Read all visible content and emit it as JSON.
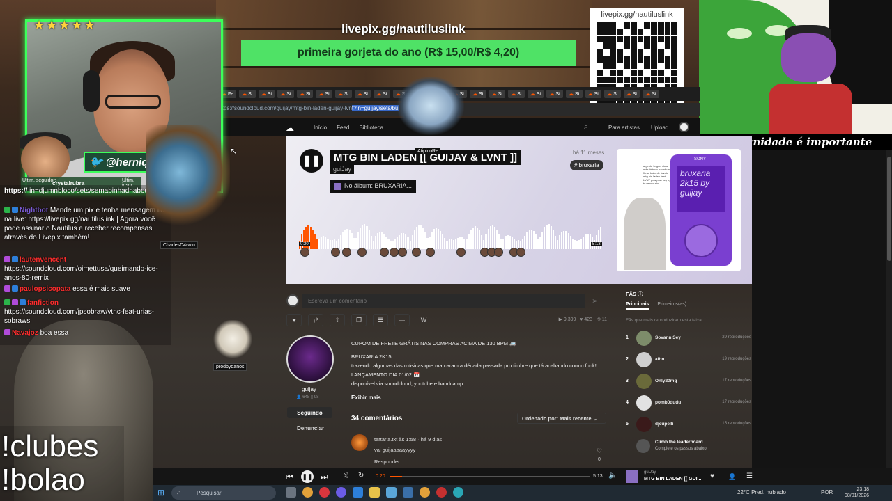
{
  "overlay": {
    "stars": "★★★★★",
    "livepix_url": "livepix.gg/nautiluslink",
    "donation_text": "primeira gorjeta do ano (R$ 15,00/R$ 4,20)",
    "qr_url": "livepix.gg/nautiluslink",
    "art_caption": "Comunidade é importante",
    "twitter_handle": "@herniq",
    "last_sub_label": "Ultim. seguidor:",
    "last_sub_name": "crystalrubra",
    "last_other_label": "Ultim. inscr.",
    "commands": [
      "!clubes",
      "!bolao"
    ],
    "sprite_labels": {
      "ghost": "AtipicoRe",
      "charles": "CharlesD4rwin",
      "cat": "prodbydanos"
    }
  },
  "browser": {
    "tabs": [
      "Fe",
      "St",
      "St",
      "St",
      "St",
      "St",
      "St",
      "St",
      "St",
      "St",
      "St",
      "St",
      "St",
      "St",
      "St",
      "St",
      "St",
      "St",
      "St",
      "St",
      "St",
      "St",
      "St"
    ],
    "address_prefix": "https://soundcloud.com/guijay/mtg-bin-laden-guijay-lvn",
    "address_selected": "t?in=guijay/sets/bu"
  },
  "sc_nav": {
    "home": "Início",
    "feed": "Feed",
    "library": "Biblioteca",
    "for_artists": "Para artistas",
    "upload": "Upload"
  },
  "track": {
    "title": "MTG BIN LADEN [[ GUIJAY & LVNT ]]",
    "artist": "guiJay",
    "album": "No álbum: BRUXARIA...",
    "date": "há 11 meses",
    "genre": "# bruxaria",
    "time_current": "0:20",
    "time_total": "5:13",
    "progress": 0.064,
    "album_art_text": "bruxaria 2k15 by guijay",
    "album_art_brand": "SONY",
    "album_art_blurb": "a gente brigou nisse mês tá tudo parado a firma baile de favela mtg bin laden feat LVNT pow pow key ky tu vendo ato"
  },
  "comment_input": {
    "placeholder": "Escreva um comentário"
  },
  "stats": {
    "plays": "▶ 9.399",
    "likes": "♥ 423",
    "reposts": "⟲ 11"
  },
  "uploader": {
    "name": "guijay",
    "followers": "👤 648   ▯ 98",
    "follow_label": "Seguindo",
    "report_label": "Denunciar"
  },
  "description": {
    "lines": [
      "CUPOM DE FRETE GRÁTIS NAS COMPRAS ACIMA DE 130 BPM 🚐",
      "BRUXARIA 2K15",
      "trazendo algumas das músicas que marcaram a década passada pro timbre que tá acabando com o funk!",
      "LANÇAMENTO DIA 01/02 📅",
      "disponível via soundcloud, youtube e bandcamp."
    ],
    "show_more": "Exibir mais"
  },
  "comments": {
    "heading": "34 comentários",
    "sort_label": "Ordenado por: Mais recente",
    "items": [
      {
        "meta": "tartaria.txt às 1:58 · há 9 dias",
        "text": "vai guijaaaaayyyy",
        "reply": "Responder",
        "likes": "0"
      }
    ]
  },
  "fans": {
    "heading": "FÃS ⓘ",
    "tab_main": "Principais",
    "tab_first": "Primeiros(as)",
    "subtitle": "Fãs que mais reproduziram esta faixa:",
    "items": [
      {
        "rank": "1",
        "name": "Sovann Sey",
        "plays": "29 reproduções",
        "color": "#7d8c6a"
      },
      {
        "rank": "2",
        "name": "aibn",
        "plays": "19 reproduções",
        "color": "#cfcfcf"
      },
      {
        "rank": "3",
        "name": "Only20mg",
        "plays": "17 reproduções",
        "color": "#6a6a3a"
      },
      {
        "rank": "4",
        "name": "pomb0dudu",
        "plays": "17 reproduções",
        "color": "#e2e2e2"
      },
      {
        "rank": "5",
        "name": "djcupelli",
        "plays": "15 reproduções",
        "color": "#3a1a1a"
      }
    ],
    "climb_title": "Climb the leaderboard",
    "climb_sub": "Complete os passos abaixo:"
  },
  "chat": {
    "lines": [
      {
        "user": "https://",
        "text": "in=djumnbloco/sets/semabinhadhabout...",
        "color": "#ffffff",
        "badges": []
      },
      {
        "user": "Nightbot",
        "text": "Mande um pix e tenha mensagem lida na live: https://livepix.gg/nautiluslink | Agora você pode assinar o Nautilus e receber recompensas através do Livepix também!",
        "color": "#7b5bd6",
        "badges": [
          "mod",
          "pr"
        ]
      },
      {
        "user": "lautenvencent",
        "text": "https://soundcloud.com/oimettusa/queimando-ice-anos-80-remix",
        "color": "#ff2d2d",
        "badges": [
          "sub",
          "pr"
        ]
      },
      {
        "user": "paulopsicopata",
        "text": "essa é mais suave",
        "color": "#ff2d2d",
        "badges": [
          "sub",
          "pr"
        ]
      },
      {
        "user": "fanfiction",
        "text": "https://soundcloud.com/jpsobraw/vtnc-feat-urias-sobraws",
        "color": "#ff2d2d",
        "badges": [
          "mod",
          "sub",
          "pr"
        ]
      },
      {
        "user": "Navajoz",
        "text": "boa essa",
        "color": "#ff2d2d",
        "badges": [
          "sub"
        ]
      }
    ]
  },
  "player": {
    "time_current": "0:20",
    "time_total": "5:13",
    "progress": 0.064,
    "artist": "guiJay",
    "title": "MTG BIN LADEN [[ GUI..."
  },
  "taskbar": {
    "search_placeholder": "Pesquisar",
    "weather": "22°C  Pred. nublado",
    "lang": "POR",
    "time": "23:18",
    "date": "08/01/2026"
  },
  "colors": {
    "soundcloud_orange": "#ff5500",
    "overlay_green": "#4fe266",
    "webcam_border": "#3cff5a"
  }
}
